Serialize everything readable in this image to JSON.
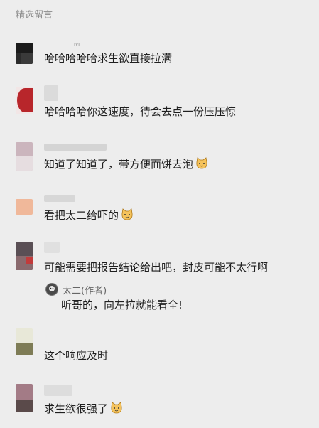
{
  "section": {
    "title": "精选留言"
  },
  "comments": [
    {
      "text": "哈哈哈哈哈求生欲直接拉满"
    },
    {
      "text": "哈哈哈哈你这速度，待会去点一份压压惊"
    },
    {
      "text": "知道了知道了，带方便面饼去泡",
      "emoji": "cat-face-icon"
    },
    {
      "text": "看把太二给吓的",
      "emoji": "cat-face-icon"
    },
    {
      "text": "可能需要把报告结论给出吧，封皮可能不太行啊"
    },
    {
      "text": "这个响应及时"
    },
    {
      "text": "求生欲很强了",
      "emoji": "cat-face-icon"
    }
  ],
  "reply": {
    "author": "太二(作者)",
    "text": "听哥的，向左拉就能看全!"
  },
  "colors": {
    "background": "#ededed",
    "text": "#1f1f1f",
    "muted": "#8a8a8a"
  }
}
